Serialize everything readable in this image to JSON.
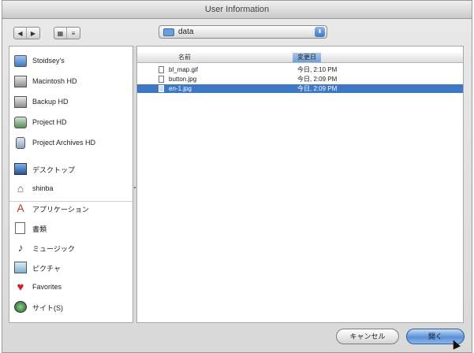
{
  "window": {
    "title": "User Information"
  },
  "toolbar": {
    "back_glyph": "◀",
    "forward_glyph": "▶",
    "view_icon_glyph": "▦",
    "view_list_glyph": "≡",
    "path_folder": "data",
    "path_arrows": "⬍"
  },
  "sidebar": {
    "devices": [
      {
        "label": "Stoidsey's",
        "icon": "computer-icon"
      },
      {
        "label": "Macintosh HD",
        "icon": "hard-disk-icon"
      },
      {
        "label": "Backup HD",
        "icon": "hard-disk-icon"
      },
      {
        "label": "Project HD",
        "icon": "network-disk-icon"
      },
      {
        "label": "Project Archives HD",
        "icon": "disk-icon"
      }
    ],
    "places": [
      {
        "label": "デスクトップ",
        "icon": "desktop-icon"
      },
      {
        "label": "shinba",
        "icon": "home-icon"
      },
      {
        "label": "アプリケーション",
        "icon": "applications-icon"
      },
      {
        "label": "書類",
        "icon": "documents-icon"
      },
      {
        "label": "ミュージック",
        "icon": "music-icon"
      },
      {
        "label": "ピクチャ",
        "icon": "pictures-icon"
      },
      {
        "label": "Favorites",
        "icon": "favorites-heart-icon"
      },
      {
        "label": "サイト(S)",
        "icon": "globe-icon"
      }
    ]
  },
  "file_list": {
    "columns": {
      "name": "名前",
      "date": "変更日"
    },
    "rows": [
      {
        "name": "bl_map.gif",
        "date": "今日, 2:10 PM",
        "selected": false
      },
      {
        "name": "button.jpg",
        "date": "今日, 2:09 PM",
        "selected": false
      },
      {
        "name": "en-1.jpg",
        "date": "今日, 2:09 PM",
        "selected": true
      }
    ]
  },
  "buttons": {
    "cancel": "キャンセル",
    "open": "開く"
  },
  "colors": {
    "selection": "#3e78c4",
    "default_button": "#5a90d8"
  }
}
